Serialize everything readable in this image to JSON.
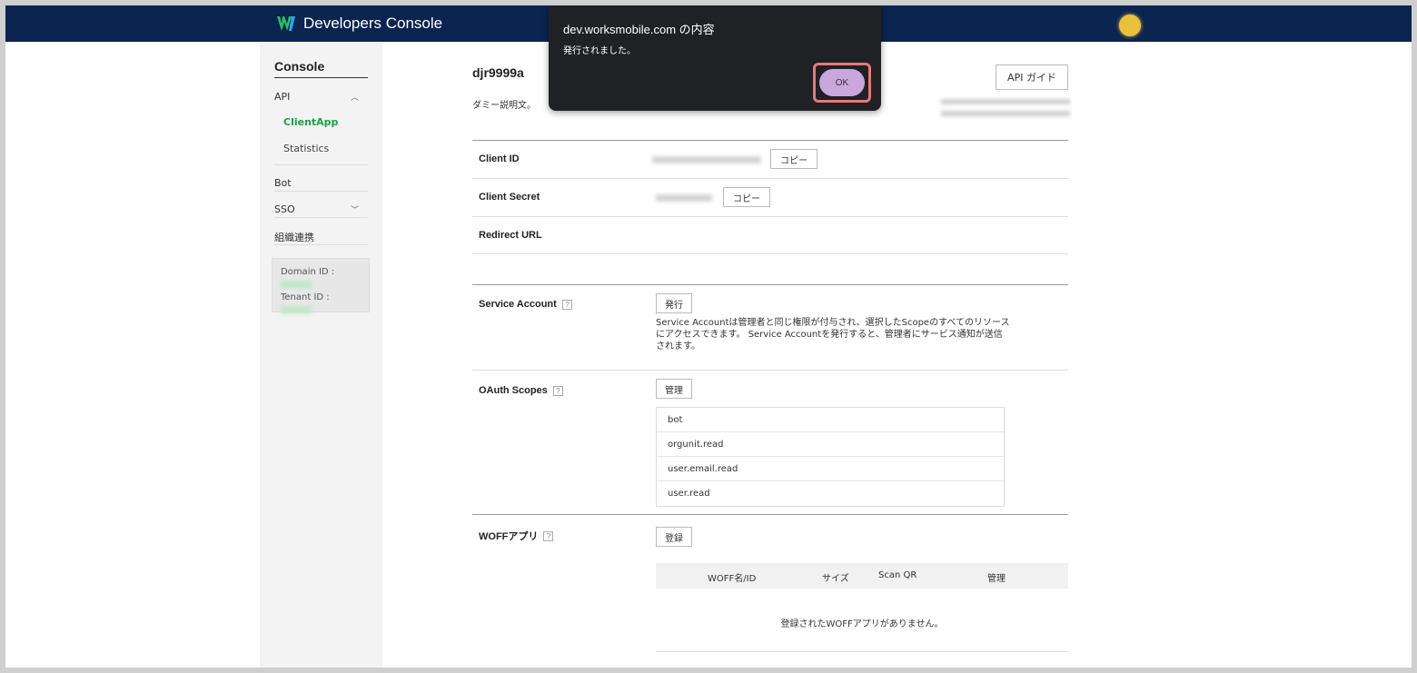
{
  "header": {
    "brand": "Developers Console"
  },
  "sidebar": {
    "title": "Console",
    "items": [
      {
        "label": "API",
        "chevron": "︿"
      },
      {
        "label": "ClientApp"
      },
      {
        "label": "Statistics"
      },
      {
        "label": "Bot"
      },
      {
        "label": "SSO",
        "chevron": "﹀"
      },
      {
        "label": "組織連携"
      }
    ],
    "domain_label": "Domain ID :",
    "tenant_label": "Tenant ID :"
  },
  "app": {
    "name": "djr9999a",
    "description": "ダミー説明文。",
    "api_guide": "API ガイド"
  },
  "rows": {
    "client_id": "Client ID",
    "client_secret": "Client Secret",
    "redirect_url": "Redirect URL",
    "copy": "コピー",
    "service_account": "Service Account",
    "issue_button": "発行",
    "sa_description": "Service Accountは管理者と同じ権限が付与され、選択したScopeのすべてのリソースにアクセスできます。 Service Accountを発行すると、管理者にサービス通知が送信されます。",
    "oauth_scopes": "OAuth Scopes",
    "manage_button": "管理",
    "scopes": [
      "bot",
      "orgunit.read",
      "user.email.read",
      "user.read"
    ],
    "woff_apps": "WOFFアプリ",
    "register_button": "登録",
    "woff_columns": [
      "WOFF名/ID",
      "サイズ",
      "Scan QR",
      "管理"
    ],
    "woff_empty": "登録されたWOFFアプリがありません。",
    "help": "?"
  },
  "dialog": {
    "title": "dev.worksmobile.com の内容",
    "message": "発行されました。",
    "ok": "OK"
  },
  "colors": {
    "header": "#0b2450",
    "active": "#19a04a",
    "dialog": "#202124",
    "ok_button": "#c9a7dd",
    "highlight": "#e8777a"
  }
}
